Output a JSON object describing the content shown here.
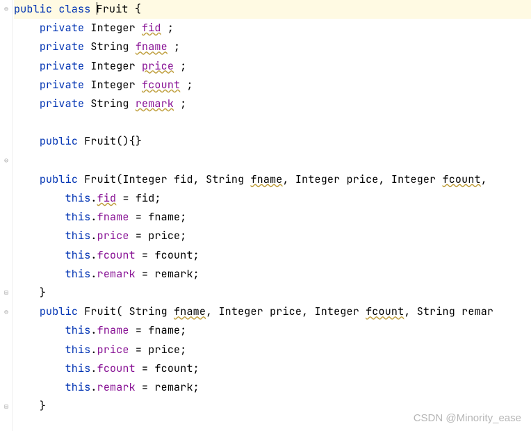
{
  "code": {
    "l1": {
      "kw1": "public",
      "kw2": "class",
      "name": "Fruit",
      "brace": "{"
    },
    "l2": {
      "kw": "private",
      "type": "Integer",
      "field": "fid",
      "semi": ";"
    },
    "l3": {
      "kw": "private",
      "type": "String",
      "field": "fname",
      "semi": ";"
    },
    "l4": {
      "kw": "private",
      "type": "Integer",
      "field": "price",
      "semi": ";"
    },
    "l5": {
      "kw": "private",
      "type": "Integer",
      "field": "fcount",
      "semi": ";"
    },
    "l6": {
      "kw": "private",
      "type": "String",
      "field": "remark",
      "semi": ";"
    },
    "l7": {
      "kw": "public",
      "name": "Fruit",
      "tail": "(){}"
    },
    "l8": {
      "kw": "public",
      "name": "Fruit",
      "p1t": "Integer",
      "p1n": "fid",
      "p2t": "String",
      "p2n": "fname",
      "p3t": "Integer",
      "p3n": "price",
      "p4t": "Integer",
      "p4n": "fcount",
      "comma": ","
    },
    "l9": {
      "this": "this",
      "field": "fid",
      "eq": "=",
      "val": "fid",
      "semi": ";"
    },
    "l10": {
      "this": "this",
      "field": "fname",
      "eq": "=",
      "val": "fname",
      "semi": ";"
    },
    "l11": {
      "this": "this",
      "field": "price",
      "eq": "=",
      "val": "price",
      "semi": ";"
    },
    "l12": {
      "this": "this",
      "field": "fcount",
      "eq": "=",
      "val": "fcount",
      "semi": ";"
    },
    "l13": {
      "this": "this",
      "field": "remark",
      "eq": "=",
      "val": "remark",
      "semi": ";"
    },
    "l14": {
      "brace": "}"
    },
    "l15": {
      "kw": "public",
      "name": "Fruit",
      "p1t": "String",
      "p1n": "fname",
      "p2t": "Integer",
      "p2n": "price",
      "p3t": "Integer",
      "p3n": "fcount",
      "p4t": "String",
      "p4n": "remar"
    },
    "l16": {
      "this": "this",
      "field": "fname",
      "eq": "=",
      "val": "fname",
      "semi": ";"
    },
    "l17": {
      "this": "this",
      "field": "price",
      "eq": "=",
      "val": "price",
      "semi": ";"
    },
    "l18": {
      "this": "this",
      "field": "fcount",
      "eq": "=",
      "val": "fcount",
      "semi": ";"
    },
    "l19": {
      "this": "this",
      "field": "remark",
      "eq": "=",
      "val": "remark",
      "semi": ";"
    },
    "l20": {
      "brace": "}"
    }
  },
  "watermark": "CSDN @Minority_ease"
}
